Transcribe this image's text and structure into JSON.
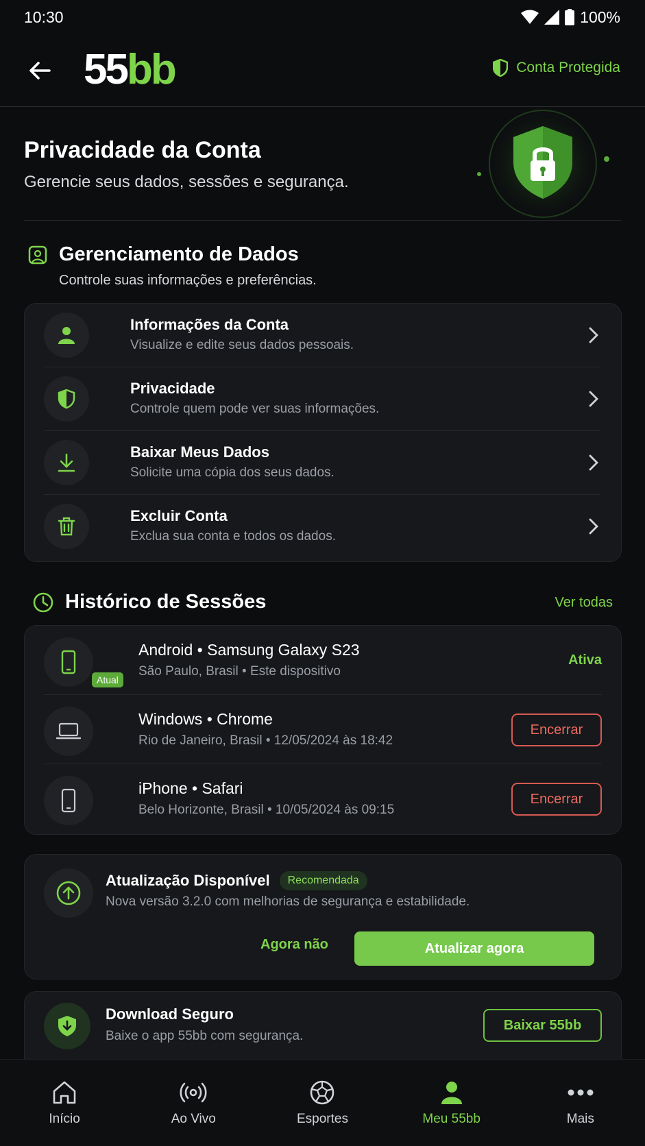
{
  "status": {
    "time": "10:30",
    "battery": "100%"
  },
  "header": {
    "logo_part1": "55",
    "logo_part2": "bb",
    "protected_label": "Conta Protegida"
  },
  "hero": {
    "title": "Privacidade da Conta",
    "subtitle": "Gerencie seus dados, sessões e segurança."
  },
  "data_section": {
    "title": "Gerenciamento de Dados",
    "subtitle": "Controle suas informações e preferências.",
    "items": [
      {
        "title": "Informações da Conta",
        "subtitle": "Visualize e edite seus dados pessoais.",
        "icon": "user-icon"
      },
      {
        "title": "Privacidade",
        "subtitle": "Controle quem pode ver suas informações.",
        "icon": "shield-icon"
      },
      {
        "title": "Baixar Meus Dados",
        "subtitle": "Solicite uma cópia dos seus dados.",
        "icon": "download-icon"
      },
      {
        "title": "Excluir Conta",
        "subtitle": "Exclua sua conta e todos os dados.",
        "icon": "trash-icon"
      }
    ]
  },
  "sessions": {
    "title": "Histórico de Sessões",
    "see_all": "Ver todas",
    "items": [
      {
        "device": "Android • Samsung Galaxy S23",
        "detail": "São Paulo, Brasil • Este dispositivo",
        "badge": "Atual",
        "status": "Ativa",
        "icon": "phone-icon"
      },
      {
        "device": "Windows • Chrome",
        "detail": "Rio de Janeiro, Brasil • 12/05/2024 às 18:42",
        "action": "Encerrar",
        "icon": "laptop-icon"
      },
      {
        "device": "iPhone • Safari",
        "detail": "Belo Horizonte, Brasil • 10/05/2024 às 09:15",
        "action": "Encerrar",
        "icon": "phone-icon"
      }
    ]
  },
  "update": {
    "title": "Atualização Disponível",
    "badge": "Recomendada",
    "subtitle": "Nova versão 3.2.0 com melhorias de segurança e estabilidade.",
    "later": "Agora não",
    "update_now": "Atualizar agora"
  },
  "download": {
    "title": "Download Seguro",
    "subtitle": "Baixe o app 55bb com segurança.",
    "button": "Baixar 55bb"
  },
  "nav": {
    "items": [
      {
        "label": "Início",
        "icon": "home-icon"
      },
      {
        "label": "Ao Vivo",
        "icon": "live-icon"
      },
      {
        "label": "Esportes",
        "icon": "ball-icon"
      },
      {
        "label": "Meu 55bb",
        "icon": "profile-icon",
        "active": true
      },
      {
        "label": "Mais",
        "icon": "more-icon"
      }
    ]
  },
  "colors": {
    "accent": "#7ed44a",
    "danger": "#ef6a5f",
    "background": "#0c0d0f",
    "card": "#17181b"
  }
}
